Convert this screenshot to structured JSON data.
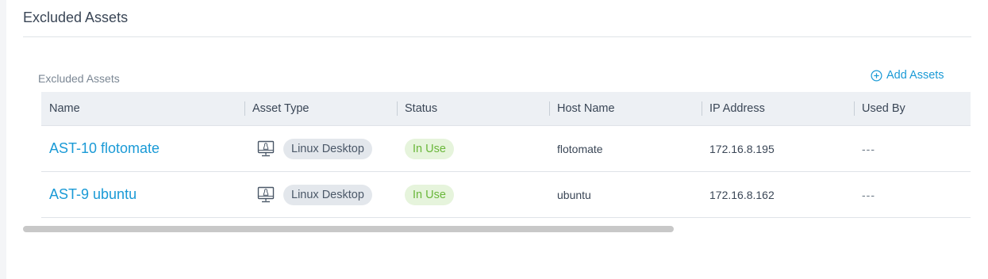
{
  "page_title": "Excluded Assets",
  "section_label": "Excluded Assets",
  "add_assets_label": "Add Assets",
  "columns": [
    "Name",
    "Asset Type",
    "Status",
    "Host Name",
    "IP Address",
    "Used By"
  ],
  "rows": [
    {
      "name": "AST-10 flotomate",
      "asset_type": "Linux Desktop",
      "status": "In Use",
      "host_name": "flotomate",
      "ip_address": "172.16.8.195",
      "used_by": "---"
    },
    {
      "name": "AST-9 ubuntu",
      "asset_type": "Linux Desktop",
      "status": "In Use",
      "host_name": "ubuntu",
      "ip_address": "172.16.8.162",
      "used_by": "---"
    }
  ],
  "icons": {
    "add": "plus-circle-icon",
    "asset_type": "linux-desktop-icon"
  },
  "colors": {
    "link": "#1a9ad6",
    "status_bg": "#e6f4dc",
    "status_text": "#6ab73a",
    "header_bg": "#edf0f4"
  }
}
